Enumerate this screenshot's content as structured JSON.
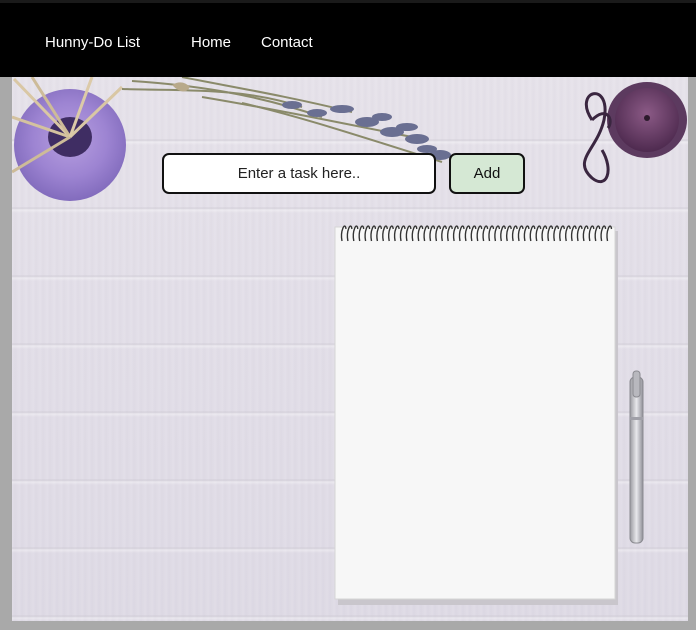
{
  "navbar": {
    "brand": "Hunny-Do List",
    "links": [
      "Home",
      "Contact"
    ]
  },
  "task_form": {
    "placeholder": "Enter a task here..",
    "add_label": "Add"
  },
  "colors": {
    "navbar_bg": "#000000",
    "add_button_bg": "#d5e8d4",
    "frame_gray": "#a9a9a9",
    "wood_lavender": "#e4e0ea"
  },
  "decor": {
    "vase": "lavender-vase-with-reeds-icon",
    "lavender": "lavender-bouquet-icon",
    "candle": "purple-candle-icon",
    "notepad": "spiral-notepad-icon",
    "pen": "silver-pen-icon"
  }
}
